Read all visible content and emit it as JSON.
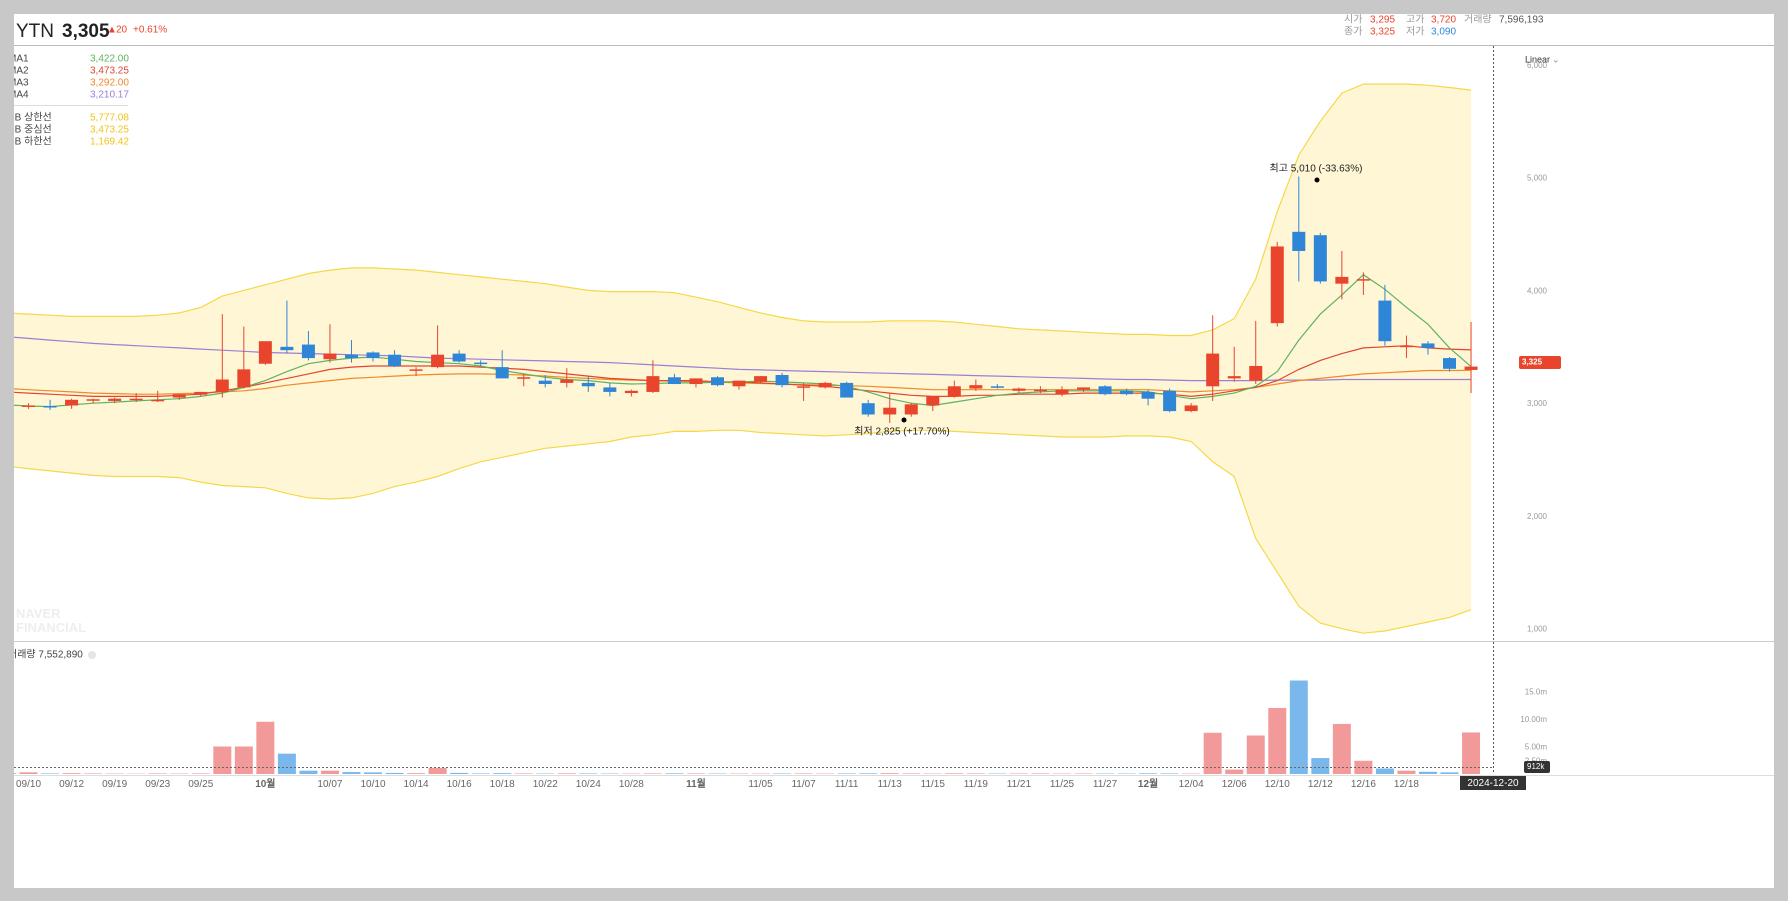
{
  "header": {
    "symbol": "YTN",
    "price": "3,305",
    "change_arrow": "▲",
    "change": "20",
    "change_pct": "+0.61%",
    "open_label": "시가",
    "open": "3,295",
    "high_label": "고가",
    "high": "3,720",
    "volume_label": "거래량",
    "volume": "7,596,193",
    "close_label": "종가",
    "close": "3,325",
    "low_label": "저가",
    "low": "3,090"
  },
  "legend": {
    "ma": [
      {
        "name": "MA1",
        "value": "3,422.00",
        "color": "#5fb35f"
      },
      {
        "name": "MA2",
        "value": "3,473.25",
        "color": "#e0462f"
      },
      {
        "name": "MA3",
        "value": "3,292.00",
        "color": "#f08a2b"
      },
      {
        "name": "MA4",
        "value": "3,210.17",
        "color": "#9b7fd4"
      }
    ],
    "bb": [
      {
        "name": "BB 상한선",
        "value": "5,777.08",
        "color": "#f0c419"
      },
      {
        "name": "BB 중심선",
        "value": "3,473.25",
        "color": "#f0c419"
      },
      {
        "name": "BB 하한선",
        "value": "1,169.42",
        "color": "#f0c419"
      }
    ]
  },
  "scale_label": "Linear",
  "watermark": [
    "NAVER",
    "FINANCIAL"
  ],
  "annotations": {
    "high": "최고 5,010 (-33.63%)",
    "low": "최저 2,825 (+17.70%)"
  },
  "price_tag": "3,325",
  "volume_title": "거래량 7,552,890",
  "volume_tag": "912k",
  "date_tag": "2024-12-20",
  "colors": {
    "up": "#e8452c",
    "down": "#2f86d6",
    "bb_fill": "#fff6d6",
    "bb_line": "#f5d84a"
  },
  "chart_data": [
    {
      "type": "candlestick",
      "title": "YTN",
      "y_scale": "linear",
      "ylim": [
        900,
        6150
      ],
      "y_ticks": [
        "1,000",
        "2,000",
        "3,000",
        "4,000",
        "5,000",
        "6,000"
      ],
      "y_tick_values": [
        1000,
        2000,
        3000,
        4000,
        5000,
        6000
      ],
      "x_tick_labels": [
        {
          "i": 1,
          "label": "09/10"
        },
        {
          "i": 3,
          "label": "09/12"
        },
        {
          "i": 5,
          "label": "09/19"
        },
        {
          "i": 7,
          "label": "09/23"
        },
        {
          "i": 9,
          "label": "09/25"
        },
        {
          "i": 12,
          "label": "10월"
        },
        {
          "i": 15,
          "label": "10/07"
        },
        {
          "i": 17,
          "label": "10/10"
        },
        {
          "i": 19,
          "label": "10/14"
        },
        {
          "i": 21,
          "label": "10/16"
        },
        {
          "i": 23,
          "label": "10/18"
        },
        {
          "i": 25,
          "label": "10/22"
        },
        {
          "i": 27,
          "label": "10/24"
        },
        {
          "i": 29,
          "label": "10/28"
        },
        {
          "i": 32,
          "label": "11월"
        },
        {
          "i": 35,
          "label": "11/05"
        },
        {
          "i": 37,
          "label": "11/07"
        },
        {
          "i": 39,
          "label": "11/11"
        },
        {
          "i": 41,
          "label": "11/13"
        },
        {
          "i": 43,
          "label": "11/15"
        },
        {
          "i": 45,
          "label": "11/19"
        },
        {
          "i": 47,
          "label": "11/21"
        },
        {
          "i": 49,
          "label": "11/25"
        },
        {
          "i": 51,
          "label": "11/27"
        },
        {
          "i": 53,
          "label": "12월"
        },
        {
          "i": 55,
          "label": "12/04"
        },
        {
          "i": 57,
          "label": "12/06"
        },
        {
          "i": 59,
          "label": "12/10"
        },
        {
          "i": 61,
          "label": "12/12"
        },
        {
          "i": 63,
          "label": "12/16"
        },
        {
          "i": 65,
          "label": "12/18"
        }
      ],
      "candles": [
        {
          "o": 2990,
          "h": 3010,
          "l": 2860,
          "c": 2960
        },
        {
          "o": 2975,
          "h": 3000,
          "l": 2950,
          "c": 2980
        },
        {
          "o": 2975,
          "h": 3030,
          "l": 2940,
          "c": 2970
        },
        {
          "o": 2980,
          "h": 3040,
          "l": 2950,
          "c": 3030
        },
        {
          "o": 3025,
          "h": 3040,
          "l": 3000,
          "c": 3035
        },
        {
          "o": 3020,
          "h": 3050,
          "l": 3000,
          "c": 3040
        },
        {
          "o": 3030,
          "h": 3090,
          "l": 3010,
          "c": 3040
        },
        {
          "o": 3030,
          "h": 3110,
          "l": 3010,
          "c": 3030
        },
        {
          "o": 3050,
          "h": 3080,
          "l": 3030,
          "c": 3080
        },
        {
          "o": 3075,
          "h": 3100,
          "l": 3060,
          "c": 3100
        },
        {
          "o": 3100,
          "h": 3790,
          "l": 3050,
          "c": 3210
        },
        {
          "o": 3140,
          "h": 3680,
          "l": 3130,
          "c": 3300
        },
        {
          "o": 3350,
          "h": 3520,
          "l": 3340,
          "c": 3550
        },
        {
          "o": 3500,
          "h": 3910,
          "l": 3440,
          "c": 3470
        },
        {
          "o": 3520,
          "h": 3640,
          "l": 3380,
          "c": 3400
        },
        {
          "o": 3390,
          "h": 3700,
          "l": 3360,
          "c": 3440
        },
        {
          "o": 3430,
          "h": 3560,
          "l": 3360,
          "c": 3400
        },
        {
          "o": 3450,
          "h": 3460,
          "l": 3370,
          "c": 3400
        },
        {
          "o": 3430,
          "h": 3470,
          "l": 3320,
          "c": 3330
        },
        {
          "o": 3290,
          "h": 3320,
          "l": 3240,
          "c": 3300
        },
        {
          "o": 3320,
          "h": 3690,
          "l": 3310,
          "c": 3430
        },
        {
          "o": 3440,
          "h": 3470,
          "l": 3360,
          "c": 3370
        },
        {
          "o": 3360,
          "h": 3380,
          "l": 3330,
          "c": 3350
        },
        {
          "o": 3320,
          "h": 3470,
          "l": 3300,
          "c": 3220
        },
        {
          "o": 3220,
          "h": 3260,
          "l": 3150,
          "c": 3230
        },
        {
          "o": 3200,
          "h": 3250,
          "l": 3140,
          "c": 3170
        },
        {
          "o": 3180,
          "h": 3310,
          "l": 3140,
          "c": 3210
        },
        {
          "o": 3180,
          "h": 3240,
          "l": 3100,
          "c": 3150
        },
        {
          "o": 3140,
          "h": 3180,
          "l": 3060,
          "c": 3100
        },
        {
          "o": 3090,
          "h": 3120,
          "l": 3060,
          "c": 3110
        },
        {
          "o": 3100,
          "h": 3380,
          "l": 3090,
          "c": 3240
        },
        {
          "o": 3230,
          "h": 3260,
          "l": 3170,
          "c": 3170
        },
        {
          "o": 3170,
          "h": 3220,
          "l": 3140,
          "c": 3220
        },
        {
          "o": 3230,
          "h": 3240,
          "l": 3150,
          "c": 3160
        },
        {
          "o": 3150,
          "h": 3200,
          "l": 3120,
          "c": 3200
        },
        {
          "o": 3190,
          "h": 3240,
          "l": 3180,
          "c": 3240
        },
        {
          "o": 3250,
          "h": 3270,
          "l": 3140,
          "c": 3160
        },
        {
          "o": 3150,
          "h": 3180,
          "l": 3020,
          "c": 3150
        },
        {
          "o": 3140,
          "h": 3190,
          "l": 3130,
          "c": 3180
        },
        {
          "o": 3180,
          "h": 3190,
          "l": 3050,
          "c": 3050
        },
        {
          "o": 3000,
          "h": 3030,
          "l": 2880,
          "c": 2900
        },
        {
          "o": 2900,
          "h": 3090,
          "l": 2825,
          "c": 2960
        },
        {
          "o": 2900,
          "h": 3000,
          "l": 2880,
          "c": 2990
        },
        {
          "o": 2980,
          "h": 3050,
          "l": 2930,
          "c": 3060
        },
        {
          "o": 3060,
          "h": 3200,
          "l": 3050,
          "c": 3150
        },
        {
          "o": 3130,
          "h": 3210,
          "l": 3110,
          "c": 3160
        },
        {
          "o": 3150,
          "h": 3170,
          "l": 3130,
          "c": 3140
        },
        {
          "o": 3110,
          "h": 3140,
          "l": 3090,
          "c": 3130
        },
        {
          "o": 3110,
          "h": 3150,
          "l": 3090,
          "c": 3120
        },
        {
          "o": 3080,
          "h": 3150,
          "l": 3060,
          "c": 3120
        },
        {
          "o": 3120,
          "h": 3140,
          "l": 3100,
          "c": 3140
        },
        {
          "o": 3150,
          "h": 3160,
          "l": 3070,
          "c": 3080
        },
        {
          "o": 3110,
          "h": 3130,
          "l": 3070,
          "c": 3080
        },
        {
          "o": 3100,
          "h": 3120,
          "l": 2980,
          "c": 3040
        },
        {
          "o": 3110,
          "h": 3130,
          "l": 2920,
          "c": 2930
        },
        {
          "o": 2930,
          "h": 3000,
          "l": 2920,
          "c": 2980
        },
        {
          "o": 3150,
          "h": 3780,
          "l": 3020,
          "c": 3440
        },
        {
          "o": 3220,
          "h": 3500,
          "l": 3190,
          "c": 3240
        },
        {
          "o": 3200,
          "h": 3730,
          "l": 3170,
          "c": 3330
        },
        {
          "o": 3710,
          "h": 4430,
          "l": 3680,
          "c": 4390
        },
        {
          "o": 4520,
          "h": 5010,
          "l": 4080,
          "c": 4350
        },
        {
          "o": 4490,
          "h": 4510,
          "l": 4060,
          "c": 4080
        },
        {
          "o": 4060,
          "h": 4350,
          "l": 3920,
          "c": 4120
        },
        {
          "o": 4090,
          "h": 4160,
          "l": 3960,
          "c": 4100
        },
        {
          "o": 3910,
          "h": 4050,
          "l": 3510,
          "c": 3550
        },
        {
          "o": 3510,
          "h": 3600,
          "l": 3400,
          "c": 3510
        },
        {
          "o": 3530,
          "h": 3550,
          "l": 3430,
          "c": 3490
        },
        {
          "o": 3400,
          "h": 3410,
          "l": 3280,
          "c": 3305
        },
        {
          "o": 3295,
          "h": 3720,
          "l": 3090,
          "c": 3325
        }
      ],
      "overlays": {
        "MA1": [
          2985,
          2975,
          2970,
          2985,
          3000,
          3010,
          3020,
          3030,
          3040,
          3060,
          3090,
          3140,
          3200,
          3280,
          3350,
          3380,
          3400,
          3410,
          3390,
          3370,
          3360,
          3350,
          3330,
          3290,
          3260,
          3230,
          3210,
          3200,
          3180,
          3170,
          3175,
          3180,
          3180,
          3185,
          3190,
          3195,
          3190,
          3180,
          3170,
          3150,
          3100,
          3040,
          3000,
          2980,
          3010,
          3040,
          3070,
          3090,
          3100,
          3110,
          3110,
          3110,
          3110,
          3100,
          3070,
          3040,
          3060,
          3090,
          3150,
          3280,
          3560,
          3790,
          3960,
          4140,
          4010,
          3850,
          3700,
          3490,
          3325
        ],
        "MA2": [
          3100,
          3090,
          3080,
          3070,
          3060,
          3060,
          3060,
          3060,
          3070,
          3080,
          3110,
          3140,
          3180,
          3220,
          3260,
          3300,
          3320,
          3330,
          3330,
          3330,
          3330,
          3330,
          3320,
          3310,
          3300,
          3280,
          3260,
          3240,
          3220,
          3210,
          3200,
          3200,
          3200,
          3190,
          3190,
          3180,
          3170,
          3160,
          3150,
          3130,
          3110,
          3090,
          3070,
          3060,
          3060,
          3070,
          3070,
          3080,
          3080,
          3080,
          3090,
          3090,
          3090,
          3090,
          3080,
          3060,
          3080,
          3110,
          3140,
          3200,
          3300,
          3380,
          3440,
          3490,
          3500,
          3510,
          3490,
          3480,
          3473
        ],
        "MA3": [
          3130,
          3120,
          3110,
          3100,
          3090,
          3085,
          3080,
          3080,
          3085,
          3090,
          3100,
          3110,
          3130,
          3160,
          3180,
          3200,
          3220,
          3230,
          3240,
          3250,
          3255,
          3260,
          3260,
          3255,
          3250,
          3240,
          3230,
          3220,
          3210,
          3205,
          3200,
          3195,
          3190,
          3185,
          3180,
          3175,
          3170,
          3165,
          3160,
          3155,
          3150,
          3140,
          3130,
          3120,
          3120,
          3120,
          3120,
          3120,
          3120,
          3120,
          3120,
          3120,
          3120,
          3120,
          3110,
          3100,
          3110,
          3120,
          3140,
          3170,
          3200,
          3220,
          3240,
          3260,
          3270,
          3280,
          3290,
          3290,
          3292
        ],
        "MA4": [
          3590,
          3575,
          3560,
          3545,
          3530,
          3520,
          3510,
          3500,
          3490,
          3480,
          3470,
          3460,
          3450,
          3445,
          3440,
          3435,
          3430,
          3425,
          3420,
          3410,
          3400,
          3395,
          3390,
          3385,
          3380,
          3375,
          3370,
          3365,
          3360,
          3350,
          3340,
          3330,
          3320,
          3310,
          3300,
          3295,
          3290,
          3285,
          3280,
          3275,
          3270,
          3265,
          3260,
          3255,
          3250,
          3245,
          3240,
          3235,
          3230,
          3225,
          3220,
          3215,
          3210,
          3210,
          3205,
          3200,
          3200,
          3200,
          3200,
          3205,
          3205,
          3205,
          3210,
          3210,
          3210,
          3210,
          3210,
          3210,
          3210
        ],
        "BB_upper": [
          3800,
          3790,
          3780,
          3770,
          3770,
          3770,
          3770,
          3780,
          3800,
          3850,
          3950,
          4000,
          4050,
          4100,
          4150,
          4180,
          4200,
          4200,
          4190,
          4180,
          4160,
          4140,
          4120,
          4100,
          4080,
          4060,
          4030,
          4000,
          3990,
          3990,
          3990,
          3980,
          3940,
          3900,
          3850,
          3800,
          3760,
          3730,
          3720,
          3720,
          3720,
          3730,
          3730,
          3730,
          3720,
          3700,
          3680,
          3660,
          3650,
          3640,
          3630,
          3620,
          3610,
          3610,
          3600,
          3600,
          3650,
          3750,
          4100,
          4700,
          5200,
          5500,
          5750,
          5830,
          5830,
          5830,
          5820,
          5800,
          5777
        ],
        "BB_lower": [
          2440,
          2420,
          2400,
          2380,
          2360,
          2350,
          2350,
          2350,
          2340,
          2300,
          2270,
          2260,
          2250,
          2200,
          2160,
          2150,
          2160,
          2200,
          2260,
          2300,
          2350,
          2420,
          2480,
          2520,
          2560,
          2600,
          2620,
          2640,
          2660,
          2700,
          2720,
          2750,
          2750,
          2760,
          2760,
          2740,
          2730,
          2720,
          2710,
          2720,
          2730,
          2750,
          2760,
          2760,
          2750,
          2740,
          2730,
          2720,
          2710,
          2700,
          2700,
          2700,
          2710,
          2710,
          2700,
          2660,
          2480,
          2350,
          1800,
          1500,
          1200,
          1050,
          1000,
          960,
          980,
          1020,
          1060,
          1100,
          1169
        ]
      }
    },
    {
      "type": "bar",
      "title": "거래량 7,552,890",
      "ylim": [
        0,
        20000000
      ],
      "y_ticks": [
        "2.50m",
        "5.00m",
        "10.00m",
        "15.0m"
      ],
      "y_tick_values": [
        2500000,
        5000000,
        10000000,
        15000000
      ],
      "values": [
        150000,
        300000,
        100000,
        150000,
        100000,
        80000,
        60000,
        100000,
        80000,
        100000,
        5000000,
        5000000,
        9500000,
        3700000,
        600000,
        600000,
        350000,
        300000,
        200000,
        150000,
        1100000,
        200000,
        100000,
        150000,
        100000,
        80000,
        120000,
        100000,
        80000,
        80000,
        100000,
        120000,
        100000,
        80000,
        80000,
        80000,
        90000,
        100000,
        80000,
        100000,
        120000,
        150000,
        100000,
        80000,
        120000,
        100000,
        80000,
        90000,
        100000,
        80000,
        90000,
        80000,
        80000,
        120000,
        100000,
        80000,
        7500000,
        800000,
        7000000,
        12000000,
        17000000,
        2900000,
        9100000,
        2400000,
        1000000,
        600000,
        400000,
        300000,
        7552890
      ]
    }
  ]
}
